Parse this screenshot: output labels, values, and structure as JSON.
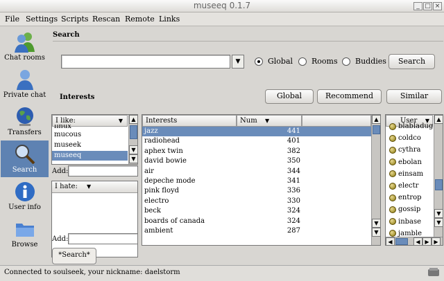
{
  "window": {
    "title": "museeq 0.1.7"
  },
  "menu": [
    "File",
    "Settings",
    "Scripts",
    "Rescan",
    "Remote",
    "Links"
  ],
  "sidebar": [
    {
      "label": "Chat rooms",
      "icon": "users-icon"
    },
    {
      "label": "Private chat",
      "icon": "user-icon"
    },
    {
      "label": "Transfers",
      "icon": "globe-icon"
    },
    {
      "label": "Search",
      "icon": "magnifier-icon",
      "active": true
    },
    {
      "label": "User info",
      "icon": "info-icon"
    },
    {
      "label": "Browse",
      "icon": "folder-icon"
    }
  ],
  "search": {
    "header": "Search",
    "query": "",
    "scopes": [
      {
        "label": "Global",
        "selected": true
      },
      {
        "label": "Rooms",
        "selected": false
      },
      {
        "label": "Buddies",
        "selected": false
      }
    ],
    "button": "Search"
  },
  "interests": {
    "header": "Interests",
    "buttons": [
      "Global",
      "Recommend",
      "Similar"
    ],
    "like_label": "I like:",
    "likes": [
      "linux",
      "mucous",
      "museek",
      "museeq"
    ],
    "like_selected": 3,
    "add_label": "Add:",
    "hate_label": "I hate:",
    "hate_add_label": "Add:",
    "table": {
      "headers": [
        "Interests",
        "Num"
      ],
      "rows": [
        [
          "jazz",
          "441"
        ],
        [
          "radiohead",
          "401"
        ],
        [
          "aphex twin",
          "382"
        ],
        [
          "david bowie",
          "350"
        ],
        [
          "air",
          "344"
        ],
        [
          "depeche mode",
          "341"
        ],
        [
          "pink floyd",
          "336"
        ],
        [
          "electro",
          "330"
        ],
        [
          "beck",
          "324"
        ],
        [
          "boards of canada",
          "324"
        ],
        [
          "ambient",
          "287"
        ]
      ],
      "selected": 0
    },
    "users_header": "User",
    "users": [
      "blabladuge",
      "coldco",
      "cythra",
      "ebolan",
      "einsam",
      "electr",
      "entrop",
      "gossip",
      "inbase",
      "jamble"
    ]
  },
  "tabs": [
    "*Search*"
  ],
  "status": "Connected to soulseek, your nickname: daelstorm"
}
